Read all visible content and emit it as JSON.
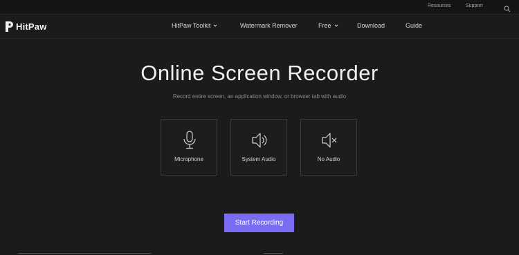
{
  "topbar": {
    "resources": "Resources",
    "support": "Support",
    "search_icon": "search-icon"
  },
  "brand": {
    "name": "HitPaw",
    "logo_icon": "hitpaw-logo-icon"
  },
  "nav": {
    "items": [
      {
        "label": "HitPaw Toolkit",
        "dropdown": true
      },
      {
        "label": "Watermark Remover",
        "dropdown": false
      },
      {
        "label": "Free",
        "dropdown": true
      },
      {
        "label": "Download",
        "dropdown": false
      },
      {
        "label": "Guide",
        "dropdown": false
      }
    ]
  },
  "hero": {
    "title": "Online Screen Recorder",
    "subtitle": "Record entire screen, an application window, or browser tab with audio"
  },
  "audio_options": [
    {
      "label": "Microphone",
      "icon": "microphone-icon"
    },
    {
      "label": "System Audio",
      "icon": "speaker-icon"
    },
    {
      "label": "No Audio",
      "icon": "mute-icon"
    }
  ],
  "actions": {
    "start_label": "Start Recording"
  },
  "colors": {
    "background": "#1b1b1b",
    "accent": "#7b6cf6",
    "border": "#3b3b3b"
  }
}
